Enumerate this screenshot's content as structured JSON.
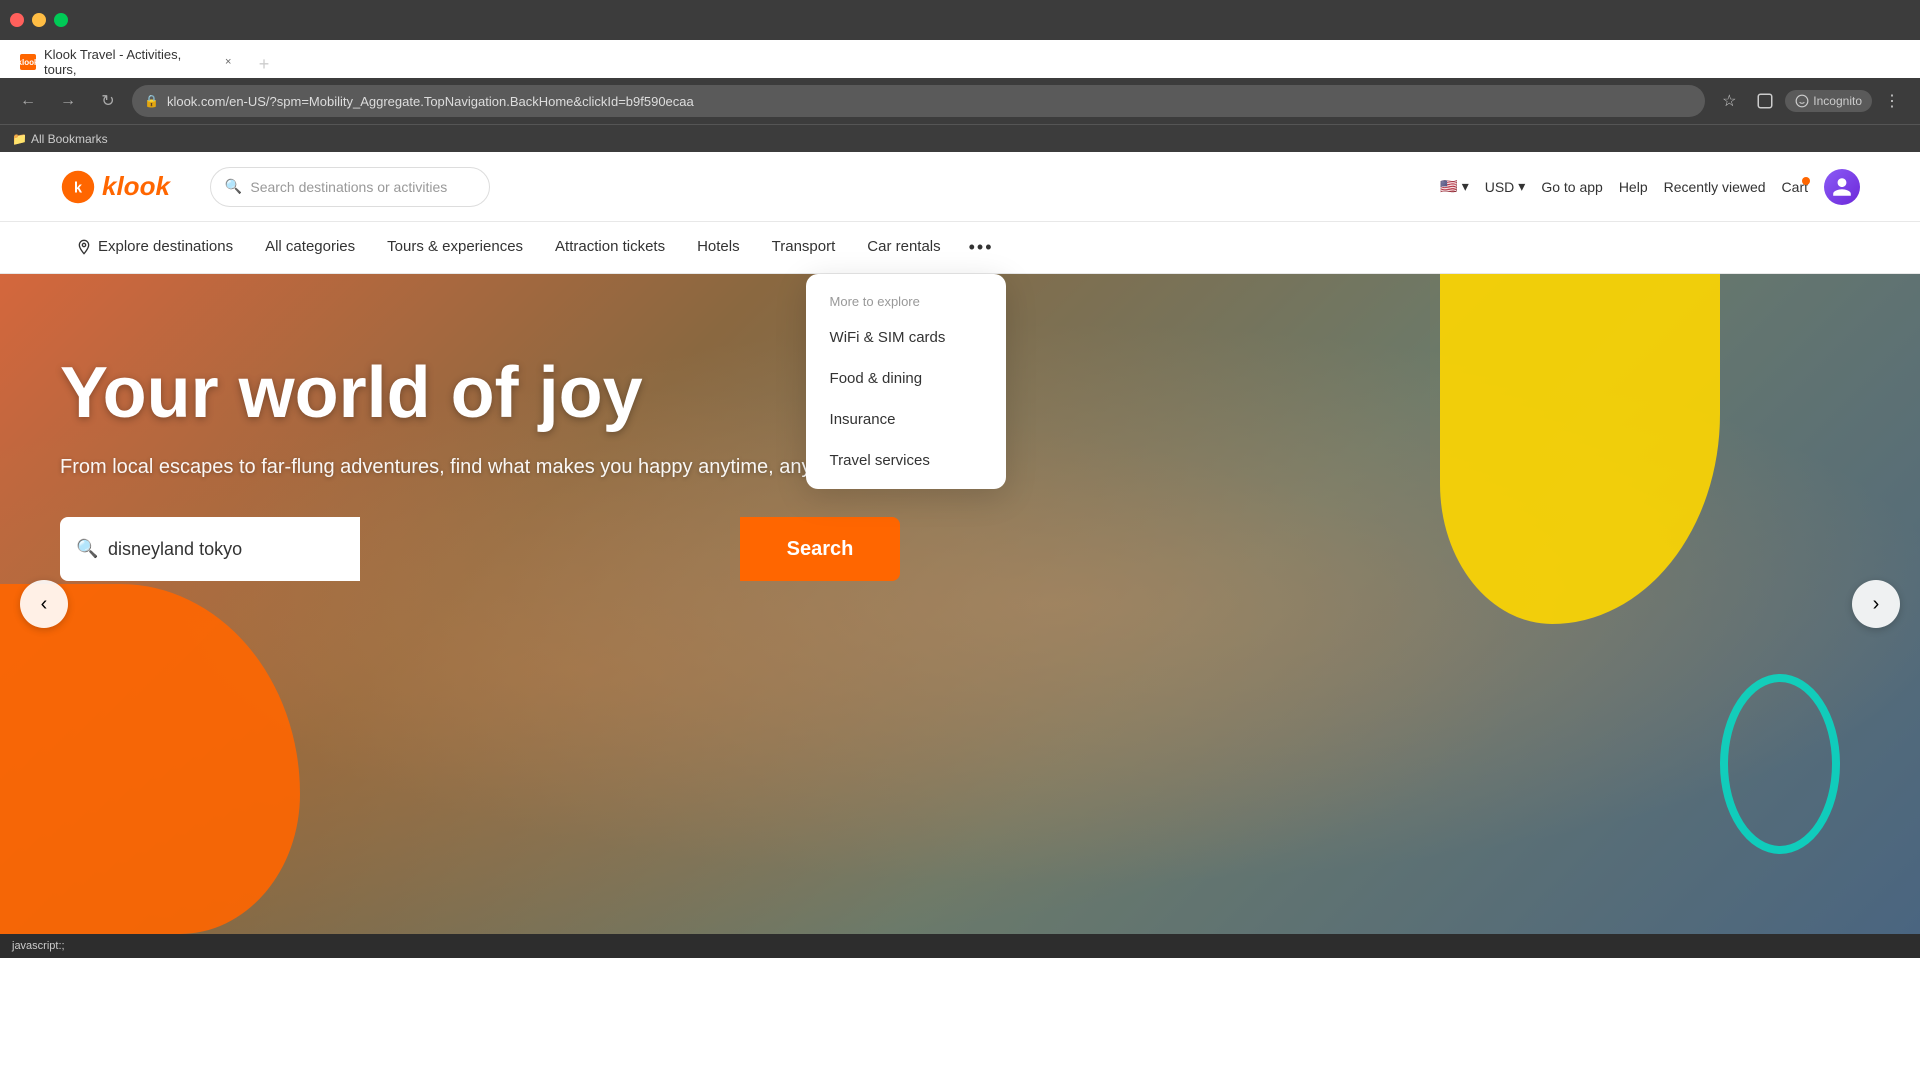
{
  "browser": {
    "tab": {
      "favicon": "K",
      "title": "Klook Travel - Activities, tours,",
      "close_icon": "×"
    },
    "new_tab_icon": "+",
    "toolbar": {
      "back_icon": "←",
      "forward_icon": "→",
      "refresh_icon": "↻",
      "url": "klook.com/en-US/?spm=Mobility_Aggregate.TopNavigation.BackHome&clickId=b9f590ecaa",
      "lock_icon": "🔒",
      "bookmark_icon": "☆",
      "profile_icon": "👤",
      "incognito_label": "Incognito",
      "menu_icon": "⋮",
      "extensions_icon": "🧩"
    },
    "bookmarks": {
      "label": "All Bookmarks",
      "folder_icon": "📁"
    }
  },
  "klook": {
    "logo_text": "klook",
    "nav": {
      "search_placeholder": "Search destinations or activities",
      "flag": "🇺🇸",
      "currency": "USD",
      "currency_arrow": "▾",
      "flag_arrow": "▾",
      "go_to_app": "Go to app",
      "help": "Help",
      "recently_viewed": "Recently viewed",
      "cart": "Cart",
      "search_icon": "🔍"
    },
    "subnav": {
      "items": [
        {
          "id": "explore",
          "label": "Explore destinations",
          "has_pin": true
        },
        {
          "id": "categories",
          "label": "All categories"
        },
        {
          "id": "tours",
          "label": "Tours & experiences"
        },
        {
          "id": "attraction",
          "label": "Attraction tickets"
        },
        {
          "id": "hotels",
          "label": "Hotels"
        },
        {
          "id": "transport",
          "label": "Transport"
        },
        {
          "id": "car-rentals",
          "label": "Car rentals"
        }
      ],
      "more_icon": "•••"
    },
    "dropdown": {
      "header": "More to explore",
      "items": [
        {
          "id": "wifi",
          "label": "WiFi & SIM cards"
        },
        {
          "id": "food",
          "label": "Food & dining"
        },
        {
          "id": "insurance",
          "label": "Insurance"
        },
        {
          "id": "travel",
          "label": "Travel services"
        }
      ]
    },
    "hero": {
      "title": "Your world of joy",
      "subtitle": "From local escapes to far-flung adventures, find what makes you happy anytime, anywhere",
      "search_placeholder": "disneyland tokyo",
      "search_btn": "Search",
      "search_icon": "🔍",
      "prev_icon": "‹",
      "next_icon": "›"
    }
  },
  "statusbar": {
    "text": "javascript:;"
  }
}
